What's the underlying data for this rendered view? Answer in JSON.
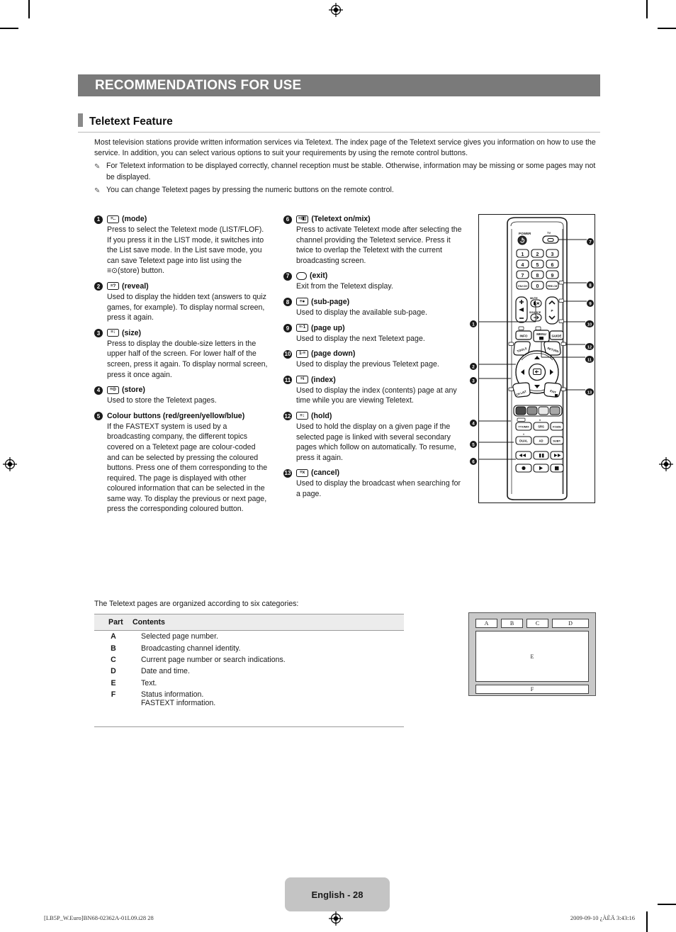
{
  "header": {
    "chapter_title": "RECOMMENDATIONS FOR USE",
    "section_title": "Teletext Feature"
  },
  "intro": {
    "paragraph": "Most television stations provide written information services via Teletext. The index page of the Teletext service gives you information on how to use the service. In addition, you can select various options to suit your requirements by using the remote control buttons.",
    "notes": [
      {
        "icon": "note-pencil-icon",
        "text": "For Teletext information to be displayed correctly, channel reception must be stable. Otherwise, information may be missing or some pages may not be displayed."
      },
      {
        "icon": "note-pencil-icon",
        "text": "You can change Teletext pages by pressing the numeric buttons on the remote control."
      }
    ]
  },
  "items_left": [
    {
      "num": "1",
      "glyph": "≡..",
      "glyph_name": "teletext-mode-icon",
      "label": "(mode)",
      "desc": "Press to select the Teletext mode (LIST/FLOF). If you press it in the LIST mode, it switches into the List save mode. In the List save mode, you can save Teletext page into list using the ≡⊙(store) button."
    },
    {
      "num": "2",
      "glyph": "≡?",
      "glyph_name": "teletext-reveal-icon",
      "label": "(reveal)",
      "desc": "Used to display the hidden text (answers to quiz games, for example). To display normal screen, press it again."
    },
    {
      "num": "3",
      "glyph": "≡↕",
      "glyph_name": "teletext-size-icon",
      "label": "(size)",
      "desc": "Press to display the double-size letters in the upper half of the screen. For lower half of the screen, press it again. To display normal screen, press it once again."
    },
    {
      "num": "4",
      "glyph": "≡⊙",
      "glyph_name": "teletext-store-icon",
      "label": "(store)",
      "desc": "Used to store the Teletext pages."
    },
    {
      "num": "5",
      "glyph": "",
      "glyph_name": "colour-buttons-icon",
      "label": "Colour buttons (red/green/yellow/blue)",
      "desc": "If the FASTEXT system is used by a broadcasting company, the different topics covered on a Teletext page are colour-coded and can be selected by pressing the coloured buttons. Press one of them corresponding to the required. The page is displayed with other coloured information that can be selected in the same way. To display the previous or next page, press the corresponding coloured button."
    }
  ],
  "items_mid": [
    {
      "num": "6",
      "glyph": "≡/◧",
      "glyph_name": "teletext-on-mix-icon",
      "label": "(Teletext on/mix)",
      "desc": "Press to activate Teletext mode after selecting the channel providing the Teletext service. Press it twice to overlap the Teletext with the current broadcasting screen."
    },
    {
      "num": "7",
      "glyph": "▭",
      "glyph_name": "tv-exit-icon",
      "label": "(exit)",
      "desc": "Exit from the Teletext display."
    },
    {
      "num": "8",
      "glyph": "≡●",
      "glyph_name": "teletext-sub-page-icon",
      "label": "(sub-page)",
      "desc": "Used to display the available sub-page."
    },
    {
      "num": "9",
      "glyph": "≡·1",
      "glyph_name": "teletext-page-up-icon",
      "label": "(page up)",
      "desc": "Used to display the next Teletext page."
    },
    {
      "num": "10",
      "glyph": "1·≡",
      "glyph_name": "teletext-page-down-icon",
      "label": "(page down)",
      "desc": "Used to display the previous Teletext page."
    },
    {
      "num": "11",
      "glyph": "≡i",
      "glyph_name": "teletext-index-icon",
      "label": "(index)",
      "desc": "Used to display the index (contents) page at any time while you are viewing Teletext."
    },
    {
      "num": "12",
      "glyph": "≡↕",
      "glyph_name": "teletext-hold-icon",
      "label": "(hold)",
      "desc": "Used to hold the display on a given page if the selected page is linked with several secondary pages which follow on automatically. To resume, press it again."
    },
    {
      "num": "13",
      "glyph": "≡x",
      "glyph_name": "teletext-cancel-icon",
      "label": "(cancel)",
      "desc": "Used to display the broadcast when searching for a page."
    }
  ],
  "remote": {
    "caption_power": "POWER",
    "caption_tv": "TV",
    "keys_numeric": [
      "1",
      "2",
      "3",
      "4",
      "5",
      "6",
      "7",
      "8",
      "9"
    ],
    "key_favch": "FAV.CH",
    "key_zero": "0",
    "key_prech": "PRE-CH",
    "label_mute": "MUTE",
    "label_source": "SOURCE",
    "label_p": "P",
    "key_info": "INFO",
    "key_menu": "MENU",
    "key_guide": "GUIDE",
    "key_tools": "TOOLS",
    "key_return": "RETURN",
    "key_chlist": "CH LIST",
    "key_exit": "EXIT",
    "key_ttxmix": "TTX/MIX",
    "key_srs": "SRS",
    "key_psize": "P.SIZE",
    "key_dual": "DUAL",
    "key_ad": "AD",
    "key_subt": "SUBT.",
    "callouts": [
      "1",
      "2",
      "3",
      "4",
      "5",
      "6",
      "7",
      "8",
      "9",
      "10",
      "11",
      "12",
      "13"
    ],
    "colour_buttons": [
      "#4a4a4a",
      "#8c8c8c",
      "#e8e8e8",
      "#a8a8a8"
    ]
  },
  "table": {
    "sentence": "The Teletext pages are organized according to six categories:",
    "columns": [
      "Part",
      "Contents"
    ],
    "rows": [
      {
        "part": "A",
        "contents": "Selected page number."
      },
      {
        "part": "B",
        "contents": "Broadcasting channel identity."
      },
      {
        "part": "C",
        "contents": "Current page number or search indications."
      },
      {
        "part": "D",
        "contents": "Date and time."
      },
      {
        "part": "E",
        "contents": "Text."
      },
      {
        "part": "F",
        "contents": "Status information."
      }
    ],
    "extra_row": "FASTEXT information."
  },
  "screen_diagram": {
    "cells_top": [
      "A",
      "B",
      "C",
      "D"
    ],
    "cell_body": "E",
    "cell_foot": "F"
  },
  "footer": {
    "page_label": "English - 28",
    "print_left": "[LB5P_W.Euro]BN68-02362A-01L09.i28   28",
    "print_right": "2009-09-10   ¿ÀÈÄ 3:43:16"
  },
  "colors": {
    "chapter_bar": "#7a7a7a",
    "section_tab": "#8a8a8a",
    "table_header": "#ececec",
    "page_tag": "#c4c4c4"
  }
}
